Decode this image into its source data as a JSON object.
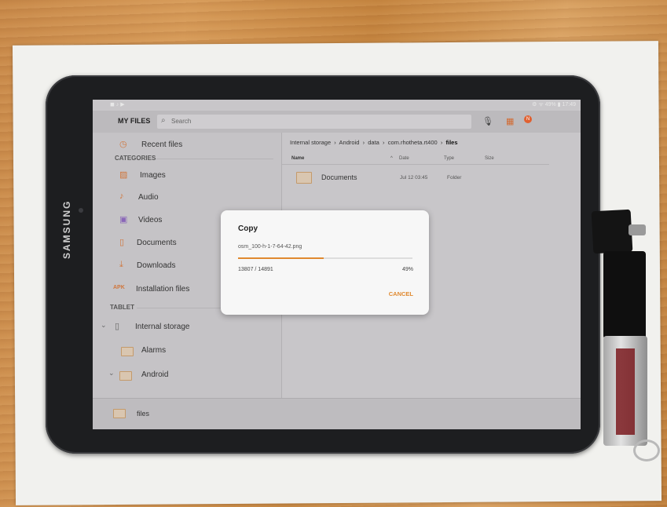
{
  "device": {
    "brand": "SAMSUNG"
  },
  "statusbar": {
    "left": "◼ ♪ ▶",
    "right": "⚙ ᯤ 49% ▮ 17:49"
  },
  "appbar": {
    "title": "MY FILES",
    "search_placeholder": "Search",
    "badge": "N"
  },
  "sidebar": {
    "recent": "Recent files",
    "categories_header": "CATEGORIES",
    "categories": [
      {
        "label": "Images",
        "icon": "image-icon"
      },
      {
        "label": "Audio",
        "icon": "music-note-icon"
      },
      {
        "label": "Videos",
        "icon": "video-icon"
      },
      {
        "label": "Documents",
        "icon": "document-icon"
      },
      {
        "label": "Downloads",
        "icon": "download-icon"
      },
      {
        "label": "Installation files",
        "icon": "apk-icon",
        "icon_text": "APK"
      }
    ],
    "tablet_header": "TABLET",
    "tablet_items": [
      {
        "label": "Internal storage"
      },
      {
        "label": "Alarms"
      },
      {
        "label": "Android"
      }
    ]
  },
  "main": {
    "breadcrumb": [
      "Internal storage",
      "Android",
      "data",
      "com.rhotheta.rt400",
      "files"
    ],
    "columns": {
      "name": "Name",
      "date": "Date",
      "type": "Type",
      "size": "Size"
    },
    "rows": [
      {
        "name": "Documents",
        "date": "Jul 12 03:45",
        "type": "Folder"
      }
    ]
  },
  "bottombar": {
    "folder_label": "files"
  },
  "dialog": {
    "title": "Copy",
    "filename": "osm_100-h-1-7-64-42.png",
    "count": "13807 / 14891",
    "percent_text": "49%",
    "progress": 0.49,
    "cancel": "CANCEL"
  },
  "colors": {
    "accent": "#e0892f",
    "folder": "#d9c6b0"
  }
}
